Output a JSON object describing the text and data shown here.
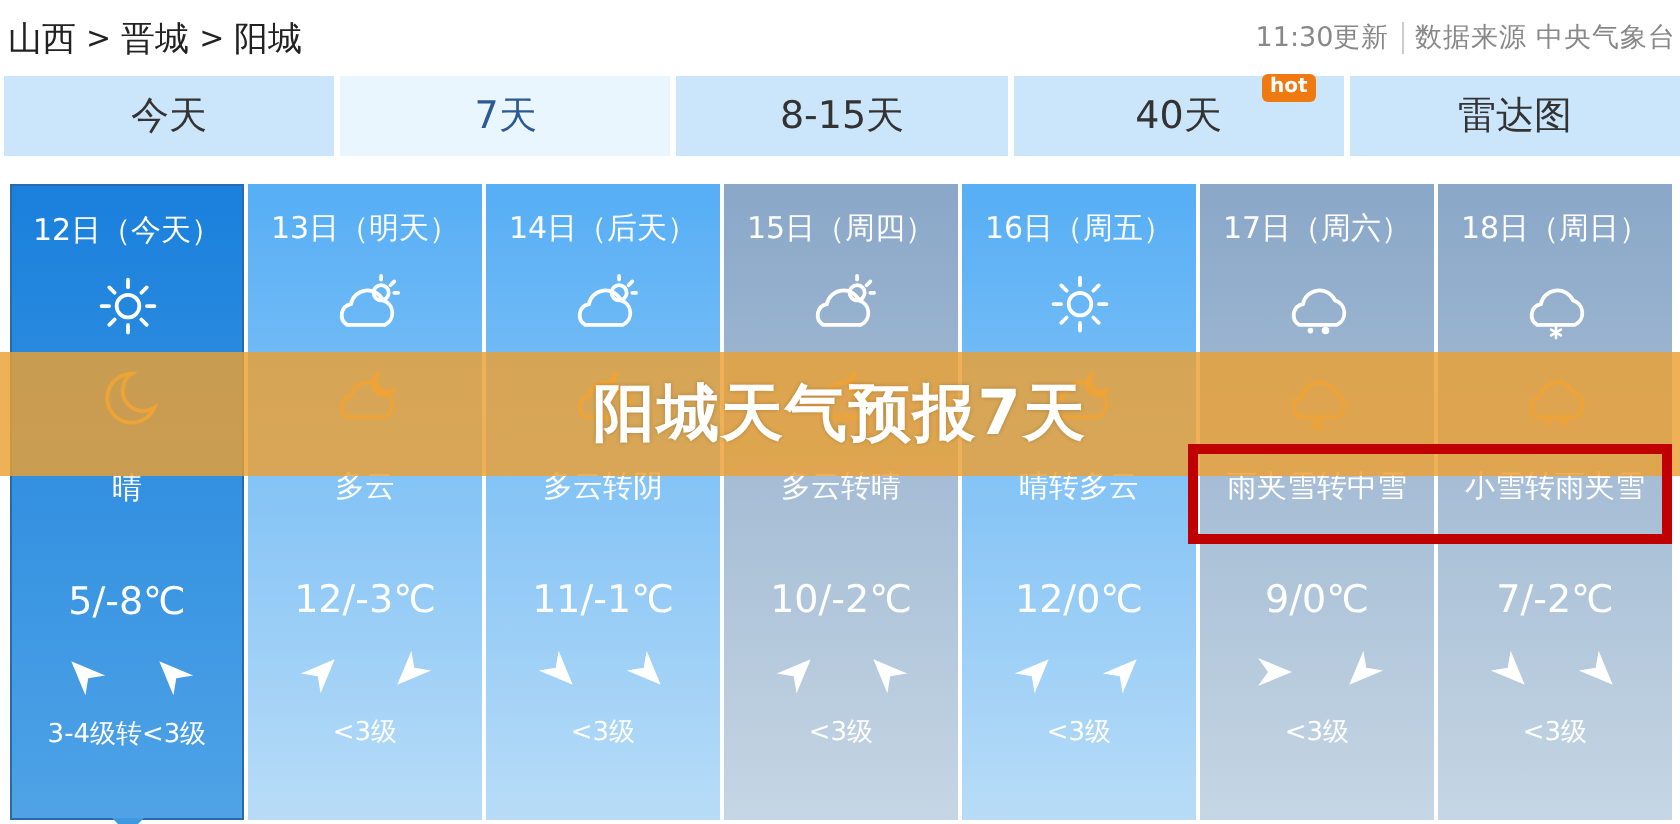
{
  "breadcrumb": [
    "山西",
    "晋城",
    "阳城"
  ],
  "breadcrumb_separator": ">",
  "update_time": "11:30更新",
  "source": "数据来源 中央气象台",
  "tabs": [
    {
      "label": "今天",
      "selected": false
    },
    {
      "label": "7天",
      "selected": true
    },
    {
      "label": "8-15天",
      "selected": false
    },
    {
      "label": "40天",
      "selected": false,
      "badge": "hot"
    },
    {
      "label": "雷达图",
      "selected": false
    }
  ],
  "days": [
    {
      "date": "12日（今天）",
      "kind": "bright",
      "selected": true,
      "day_icon": {
        "kind": "sun"
      },
      "night_icon": {
        "kind": "moon"
      },
      "condition": "晴",
      "temp": "5/-8℃",
      "wind_arrows": [
        {
          "kind": "northwest"
        },
        {
          "kind": "northwest"
        }
      ],
      "wind": "3-4级转<3级"
    },
    {
      "date": "13日（明天）",
      "kind": "bright",
      "selected": false,
      "day_icon": {
        "kind": "cloudsun"
      },
      "night_icon": {
        "kind": "cloudmoon"
      },
      "condition": "多云",
      "temp": "12/-3℃",
      "wind_arrows": [
        {
          "kind": "northeast"
        },
        {
          "kind": "southwest"
        }
      ],
      "wind": "<3级"
    },
    {
      "date": "14日（后天）",
      "kind": "bright",
      "selected": false,
      "day_icon": {
        "kind": "cloudsun"
      },
      "night_icon": {
        "kind": "cloudmoon"
      },
      "condition": "多云转阴",
      "temp": "11/-1℃",
      "wind_arrows": [
        {
          "kind": "southeast"
        },
        {
          "kind": "southeast"
        }
      ],
      "wind": "<3级"
    },
    {
      "date": "15日（周四）",
      "kind": "dull",
      "selected": false,
      "day_icon": {
        "kind": "cloudsun"
      },
      "night_icon": {
        "kind": "cloudmoon"
      },
      "condition": "多云转晴",
      "temp": "10/-2℃",
      "wind_arrows": [
        {
          "kind": "northeast"
        },
        {
          "kind": "northwest"
        }
      ],
      "wind": "<3级"
    },
    {
      "date": "16日（周五）",
      "kind": "bright",
      "selected": false,
      "day_icon": {
        "kind": "sun"
      },
      "night_icon": {
        "kind": "cloudmoon"
      },
      "condition": "晴转多云",
      "temp": "12/0℃",
      "wind_arrows": [
        {
          "kind": "northeast"
        },
        {
          "kind": "northeast"
        }
      ],
      "wind": "<3级"
    },
    {
      "date": "17日（周六）",
      "kind": "dull",
      "selected": false,
      "day_icon": {
        "kind": "sleet"
      },
      "night_icon": {
        "kind": "snow"
      },
      "condition": "雨夹雪转中雪",
      "temp": "9/0℃",
      "wind_arrows": [
        {
          "kind": "east"
        },
        {
          "kind": "southwest"
        }
      ],
      "wind": "<3级"
    },
    {
      "date": "18日（周日）",
      "kind": "dull",
      "selected": false,
      "day_icon": {
        "kind": "snow"
      },
      "night_icon": {
        "kind": "sleet"
      },
      "condition": "小雪转雨夹雪",
      "temp": "7/-2℃",
      "wind_arrows": [
        {
          "kind": "southeast"
        },
        {
          "kind": "southeast"
        }
      ],
      "wind": "<3级"
    }
  ],
  "banner": "阳城天气预报7天"
}
